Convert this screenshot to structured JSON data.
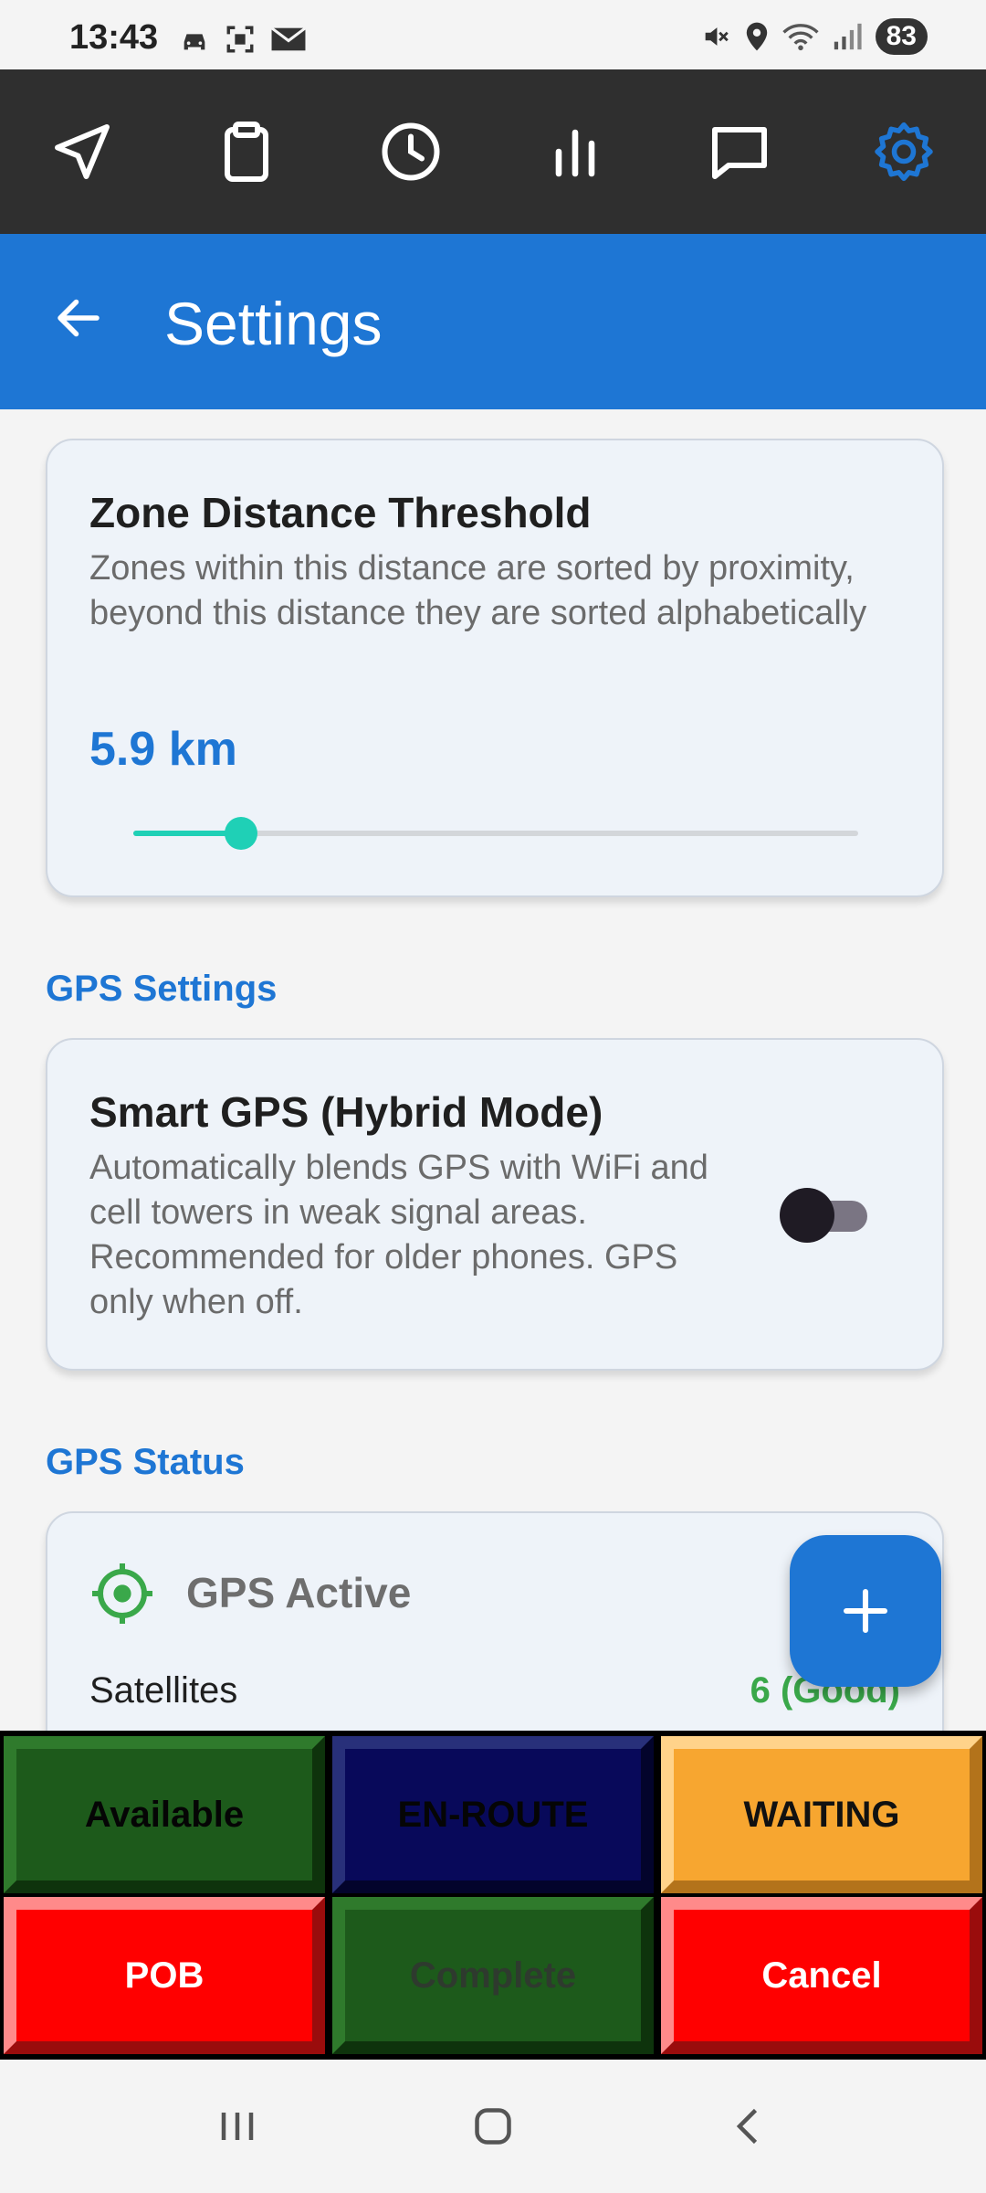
{
  "status_bar": {
    "time": "13:43",
    "battery": "83",
    "left_icons": [
      "car-icon",
      "screenshot-icon",
      "mail-icon"
    ],
    "right_icons": [
      "mute-icon",
      "location-icon",
      "wifi-icon",
      "signal-icon"
    ]
  },
  "top_nav": {
    "items": [
      {
        "icon": "navigation-arrow-icon",
        "active": false
      },
      {
        "icon": "clipboard-icon",
        "active": false
      },
      {
        "icon": "clock-icon",
        "active": false
      },
      {
        "icon": "bar-chart-icon",
        "active": false
      },
      {
        "icon": "chat-bubble-icon",
        "active": false
      },
      {
        "icon": "gear-icon",
        "active": true
      }
    ],
    "active_color": "#1e76d4",
    "inactive_color": "#ffffff"
  },
  "app_bar": {
    "title": "Settings",
    "background": "#1e76d4"
  },
  "zone_card": {
    "title": "Zone Distance Threshold",
    "description": "Zones within this distance are sorted by proximity, beyond this distance they are sorted alphabetically",
    "value": "5.9 km",
    "slider_fraction": 0.148
  },
  "gps_settings": {
    "section_title": "GPS Settings",
    "smart_gps": {
      "title": "Smart GPS (Hybrid Mode)",
      "description": "Automatically blends GPS with WiFi and cell towers in weak signal areas. Recommended for older phones. GPS only when off.",
      "enabled": false
    }
  },
  "gps_status": {
    "section_title": "GPS Status",
    "state_label": "GPS Active",
    "satellites_label": "Satellites",
    "satellites_value": "6 (Good)"
  },
  "fab": {
    "icon": "plus-icon"
  },
  "status_buttons": {
    "available": "Available",
    "en_route": "EN-ROUTE",
    "waiting": "WAITING",
    "pob": "POB",
    "complete": "Complete",
    "cancel": "Cancel"
  },
  "system_nav": [
    "recent-apps-icon",
    "home-icon",
    "back-icon"
  ]
}
